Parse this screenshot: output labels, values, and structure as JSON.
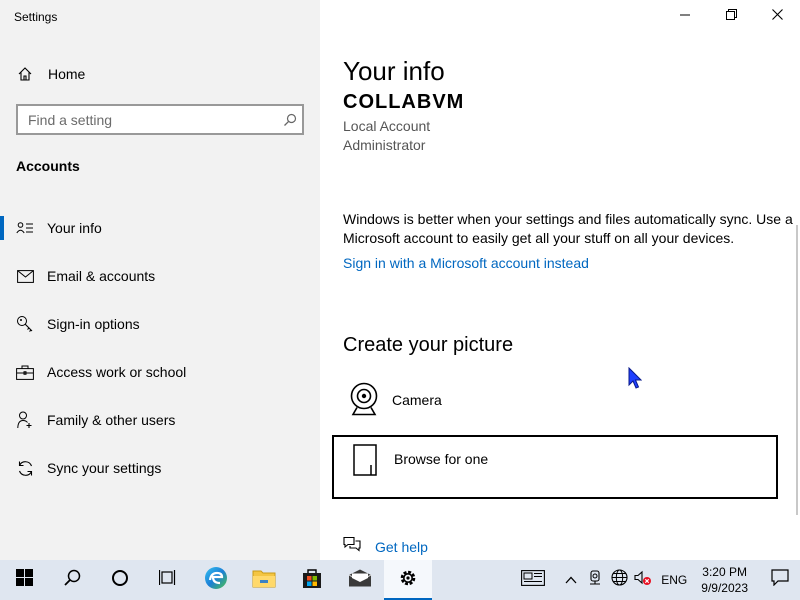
{
  "window": {
    "title": "Settings",
    "controls": [
      "minimize",
      "maximize",
      "close"
    ]
  },
  "sidebar": {
    "home_label": "Home",
    "search_placeholder": "Find a setting",
    "section_title": "Accounts",
    "items": [
      {
        "label": "Your info",
        "icon": "person-card-icon",
        "active": true
      },
      {
        "label": "Email & accounts",
        "icon": "envelope-icon",
        "active": false
      },
      {
        "label": "Sign-in options",
        "icon": "key-icon",
        "active": false
      },
      {
        "label": "Access work or school",
        "icon": "briefcase-icon",
        "active": false
      },
      {
        "label": "Family & other users",
        "icon": "person-add-icon",
        "active": false
      },
      {
        "label": "Sync your settings",
        "icon": "sync-icon",
        "active": false
      }
    ]
  },
  "main": {
    "title": "Your info",
    "username": "COLLABVM",
    "account_type": "Local Account",
    "role": "Administrator",
    "sync_text": "Windows is better when your settings and files automatically sync. Use a Microsoft account to easily get all your stuff on all your devices.",
    "signin_link": "Sign in with a Microsoft account instead",
    "picture_title": "Create your picture",
    "camera_label": "Camera",
    "browse_label": "Browse for one",
    "help_label": "Get help"
  },
  "taskbar": {
    "language": "ENG",
    "time": "3:20 PM",
    "date": "9/9/2023"
  },
  "colors": {
    "accent": "#0067c0",
    "sidebar_bg": "#f2f2f2",
    "taskbar_bg": "#dfe6f0"
  }
}
